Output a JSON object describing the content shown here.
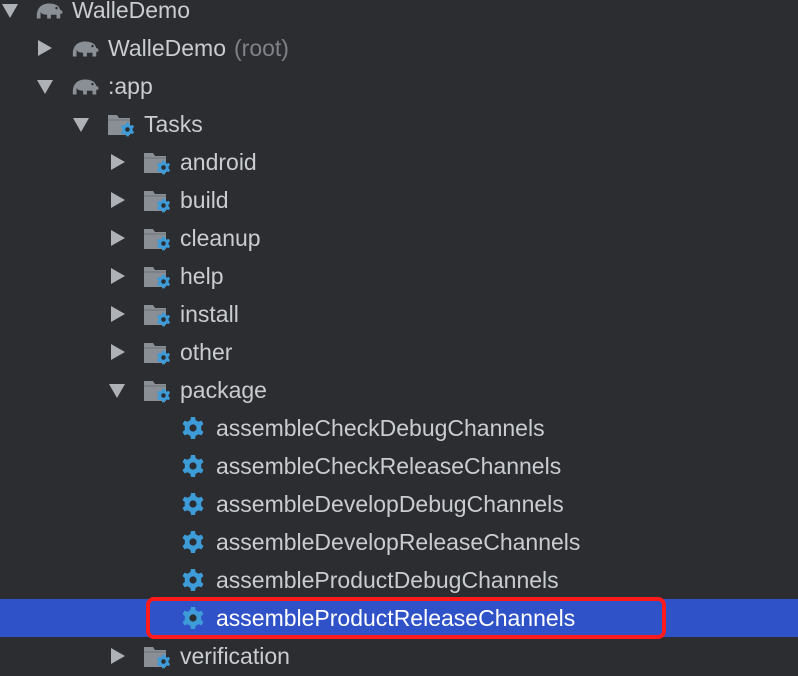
{
  "tree": {
    "root": {
      "label": "WalleDemo",
      "icon": "gradle-elephant-icon",
      "expanded": true
    },
    "root_project": {
      "label": "WalleDemo",
      "suffix": "(root)",
      "icon": "gradle-elephant-icon",
      "expanded": false
    },
    "app": {
      "label": ":app",
      "icon": "gradle-elephant-icon",
      "expanded": true
    },
    "tasks": {
      "label": "Tasks",
      "icon": "task-folder-icon",
      "expanded": true
    },
    "groups": [
      {
        "label": "android",
        "expanded": false
      },
      {
        "label": "build",
        "expanded": false
      },
      {
        "label": "cleanup",
        "expanded": false
      },
      {
        "label": "help",
        "expanded": false
      },
      {
        "label": "install",
        "expanded": false
      },
      {
        "label": "other",
        "expanded": false
      },
      {
        "label": "package",
        "expanded": true
      }
    ],
    "package_tasks": [
      {
        "label": "assembleCheckDebugChannels",
        "selected": false
      },
      {
        "label": "assembleCheckReleaseChannels",
        "selected": false
      },
      {
        "label": "assembleDevelopDebugChannels",
        "selected": false
      },
      {
        "label": "assembleDevelopReleaseChannels",
        "selected": false
      },
      {
        "label": "assembleProductDebugChannels",
        "selected": false
      },
      {
        "label": "assembleProductReleaseChannels",
        "selected": true
      }
    ],
    "verification": {
      "label": "verification",
      "expanded": false
    }
  },
  "colors": {
    "background": "#2b2d30",
    "selection": "#2f52c8",
    "highlight_border": "#ff1b1b",
    "gear": "#3d9bd8",
    "folder": "#8a8f96"
  }
}
